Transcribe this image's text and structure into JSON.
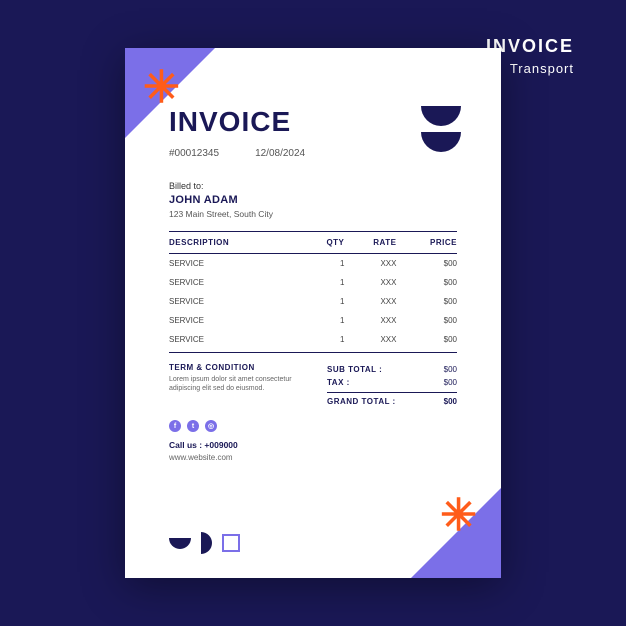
{
  "outer": {
    "title": "INVOICE",
    "subtitle": "Transport"
  },
  "doc": {
    "title": "INVOICE",
    "number": "#00012345",
    "date": "12/08/2024",
    "billed_label": "Billed to:",
    "billed_name": "JOHN ADAM",
    "billed_addr": "123 Main Street, South City",
    "headers": {
      "desc": "DESCRIPTION",
      "qty": "QTY",
      "rate": "RATE",
      "price": "PRICE"
    },
    "items": [
      {
        "desc": "SERVICE",
        "qty": "1",
        "rate": "XXX",
        "price": "$00"
      },
      {
        "desc": "SERVICE",
        "qty": "1",
        "rate": "XXX",
        "price": "$00"
      },
      {
        "desc": "SERVICE",
        "qty": "1",
        "rate": "XXX",
        "price": "$00"
      },
      {
        "desc": "SERVICE",
        "qty": "1",
        "rate": "XXX",
        "price": "$00"
      },
      {
        "desc": "SERVICE",
        "qty": "1",
        "rate": "XXX",
        "price": "$00"
      }
    ],
    "terms_label": "TERM & CONDITION",
    "terms_text": "Lorem ipsum dolor sit amet consectetur adipiscing elit sed do eiusmod.",
    "totals": {
      "subtotal_label": "SUB TOTAL :",
      "subtotal": "$00",
      "tax_label": "TAX :",
      "tax": "$00",
      "grand_label": "GRAND TOTAL :",
      "grand": "$00"
    },
    "call_label": "Call us : +009000",
    "website": "www.website.com"
  }
}
